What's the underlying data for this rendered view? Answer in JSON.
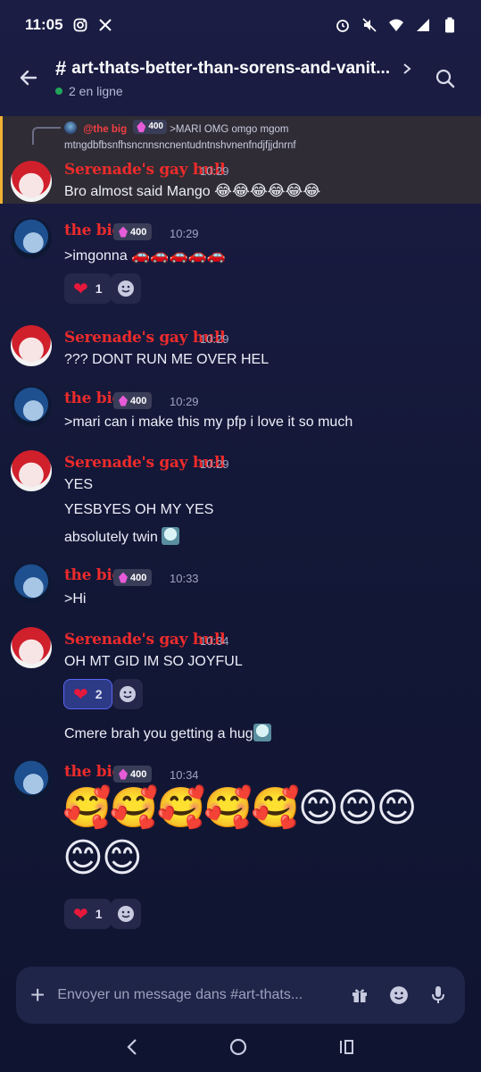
{
  "status_bar": {
    "time": "11:05"
  },
  "header": {
    "hash": "#",
    "channel_name": "art-thats-better-than-sorens-and-vanit...",
    "online_text": "2 en ligne"
  },
  "reply": {
    "author": "@the big",
    "badge": "400",
    "text": ">MARI OMG omgo mgom mtngdbfbsnfhsncnnsncnentudntnshvnenfndjfjjdnrnf"
  },
  "messages": [
    {
      "author": "Serenade's gay hull",
      "time": "10:29",
      "text": "Bro almost said Mango",
      "emoji": "😂😂😂😂😂😂"
    },
    {
      "author": "the big",
      "badge": "400",
      "time": "10:29",
      "text": ">imgonna",
      "emoji": "🚗🚗🚗🚗🚗",
      "reaction_count": "1"
    },
    {
      "author": "Serenade's gay hull",
      "time": "10:29",
      "text": "??? DONT RUN ME OVER HEL"
    },
    {
      "author": "the big",
      "badge": "400",
      "time": "10:29",
      "text": ">mari can i make this my pfp i love it so much"
    },
    {
      "author": "Serenade's gay hull",
      "time": "10:29",
      "lines": [
        "YES",
        "YESBYES OH MY YES",
        "absolutely twin"
      ]
    },
    {
      "author": "the big",
      "badge": "400",
      "time": "10:33",
      "text": ">Hi"
    },
    {
      "author": "Serenade's gay hull",
      "time": "10:34",
      "text": "OH MT GID IM SO JOYFUL",
      "reaction_count": "2",
      "followup": "Cmere brah you getting a hug"
    },
    {
      "author": "the big",
      "badge": "400",
      "time": "10:34",
      "emoji_row1": "🥰🥰🥰🥰🥰😊😊😊",
      "emoji_row2": "😊😊",
      "reaction_count": "1"
    }
  ],
  "composer": {
    "placeholder": "Envoyer un message dans #art-thats..."
  },
  "colors": {
    "author_red": "#ee2b2b",
    "accent": "#5865f2",
    "highlight_bar": "#f0b232"
  }
}
